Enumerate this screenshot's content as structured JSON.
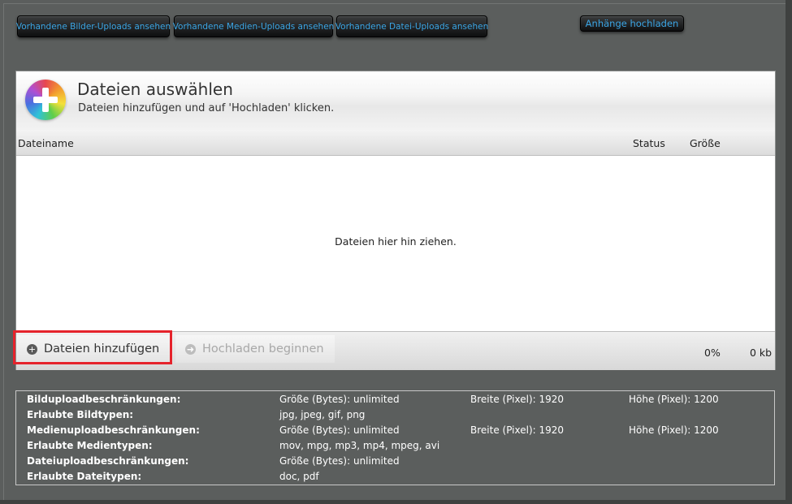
{
  "top_buttons": {
    "images": "Vorhandene Bilder-Uploads ansehen",
    "media": "Vorhandene Medien-Uploads ansehen",
    "files": "Vorhandene Datei-Uploads ansehen",
    "attach": "Anhänge hochladen"
  },
  "uploader": {
    "title": "Dateien auswählen",
    "subtitle": "Dateien hinzufügen und auf 'Hochladen' klicken.",
    "columns": {
      "name": "Dateiname",
      "status": "Status",
      "size": "Größe"
    },
    "drop_text": "Dateien hier hin ziehen.",
    "add_button": "Dateien hinzufügen",
    "upload_button": "Hochladen beginnen",
    "percent": "0%",
    "total_size": "0 kb"
  },
  "restrictions": [
    {
      "label": "Bilduploadbeschränkungen:",
      "v1": "Größe (Bytes):  unlimited",
      "v2": "Breite (Pixel):  1920",
      "v3": "Höhe (Pixel):  1200"
    },
    {
      "label": "Erlaubte Bildtypen:",
      "v1": "jpg, jpeg, gif, png",
      "v2": "",
      "v3": ""
    },
    {
      "label": "Medienuploadbeschränkungen:",
      "v1": "Größe (Bytes):  unlimited",
      "v2": "Breite (Pixel):  1920",
      "v3": "Höhe (Pixel):  1200"
    },
    {
      "label": "Erlaubte Medientypen:",
      "v1": "mov, mpg, mp3, mp4, mpeg, avi",
      "v2": "",
      "v3": ""
    },
    {
      "label": "Dateiuploadbeschränkungen:",
      "v1": "Größe (Bytes):  unlimited",
      "v2": "",
      "v3": ""
    },
    {
      "label": "Erlaubte Dateitypen:",
      "v1": "doc, pdf",
      "v2": "",
      "v3": ""
    }
  ],
  "colors": {
    "accent_link": "#3ba6e6",
    "highlight": "#e5232c",
    "background": "#5b5e5d"
  },
  "icons": {
    "logo": "add-plus-rainbow-icon",
    "add": "plus-circle-icon",
    "upload": "arrow-right-circle-icon"
  }
}
